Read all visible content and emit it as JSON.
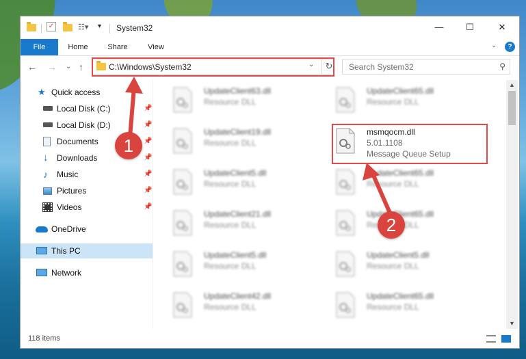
{
  "titlebar": {
    "title": "System32",
    "minimize": "—",
    "maximize": "☐",
    "close": "✕"
  },
  "ribbon": {
    "tabs": [
      "File",
      "Home",
      "Share",
      "View"
    ],
    "expand": "⌄",
    "help": "?"
  },
  "nav": {
    "back": "←",
    "forward": "→",
    "recent": "⌄",
    "up": "↑",
    "address": "C:\\Windows\\System32",
    "address_drop": "⌄",
    "refresh": "↻",
    "search_placeholder": "Search System32",
    "search_icon": "⚲"
  },
  "sidebar": {
    "items": [
      {
        "label": "Quick access",
        "icon": "star-icon",
        "pinned": false
      },
      {
        "label": "Local Disk (C:)",
        "icon": "drive-icon",
        "pinned": true
      },
      {
        "label": "Local Disk (D:)",
        "icon": "drive-icon",
        "pinned": true
      },
      {
        "label": "Documents",
        "icon": "documents-icon",
        "pinned": true
      },
      {
        "label": "Downloads",
        "icon": "download-icon",
        "pinned": true
      },
      {
        "label": "Music",
        "icon": "music-icon",
        "pinned": true
      },
      {
        "label": "Pictures",
        "icon": "pictures-icon",
        "pinned": true
      },
      {
        "label": "Videos",
        "icon": "videos-icon",
        "pinned": true
      },
      {
        "label": "OneDrive",
        "icon": "cloud-icon",
        "pinned": false
      },
      {
        "label": "This PC",
        "icon": "computer-icon",
        "pinned": false,
        "selected": true
      },
      {
        "label": "Network",
        "icon": "network-icon",
        "pinned": false
      }
    ],
    "pin_glyph": "📌"
  },
  "files": [
    {
      "name": "UpdateClient63.dll",
      "type": "Resource DLL"
    },
    {
      "name": "UpdateClient65.dll",
      "type": "Resource DLL"
    },
    {
      "name": "UpdateClient19.dll",
      "type": "Resource DLL"
    },
    {
      "name": "msmqocm.dll",
      "version": "5.01.1108",
      "description": "Message Queue Setup",
      "highlighted": true
    },
    {
      "name": "UpdateClient5.dll",
      "type": "Resource DLL"
    },
    {
      "name": "UpdateClient65.dll",
      "type": "Resource DLL"
    },
    {
      "name": "UpdateClient21.dll",
      "type": "Resource DLL"
    },
    {
      "name": "UpdateClient65.dll",
      "type": "Resource DLL"
    },
    {
      "name": "UpdateClient5.dll",
      "type": "Resource DLL"
    },
    {
      "name": "UpdateClient5.dll",
      "type": "Resource DLL"
    },
    {
      "name": "UpdateClient42.dll",
      "type": "Resource DLL"
    },
    {
      "name": "UpdateClient65.dll",
      "type": "Resource DLL"
    }
  ],
  "status": {
    "item_count": "118 items"
  },
  "annotations": {
    "step1": "1",
    "step2": "2",
    "color": "#e24a4a"
  }
}
